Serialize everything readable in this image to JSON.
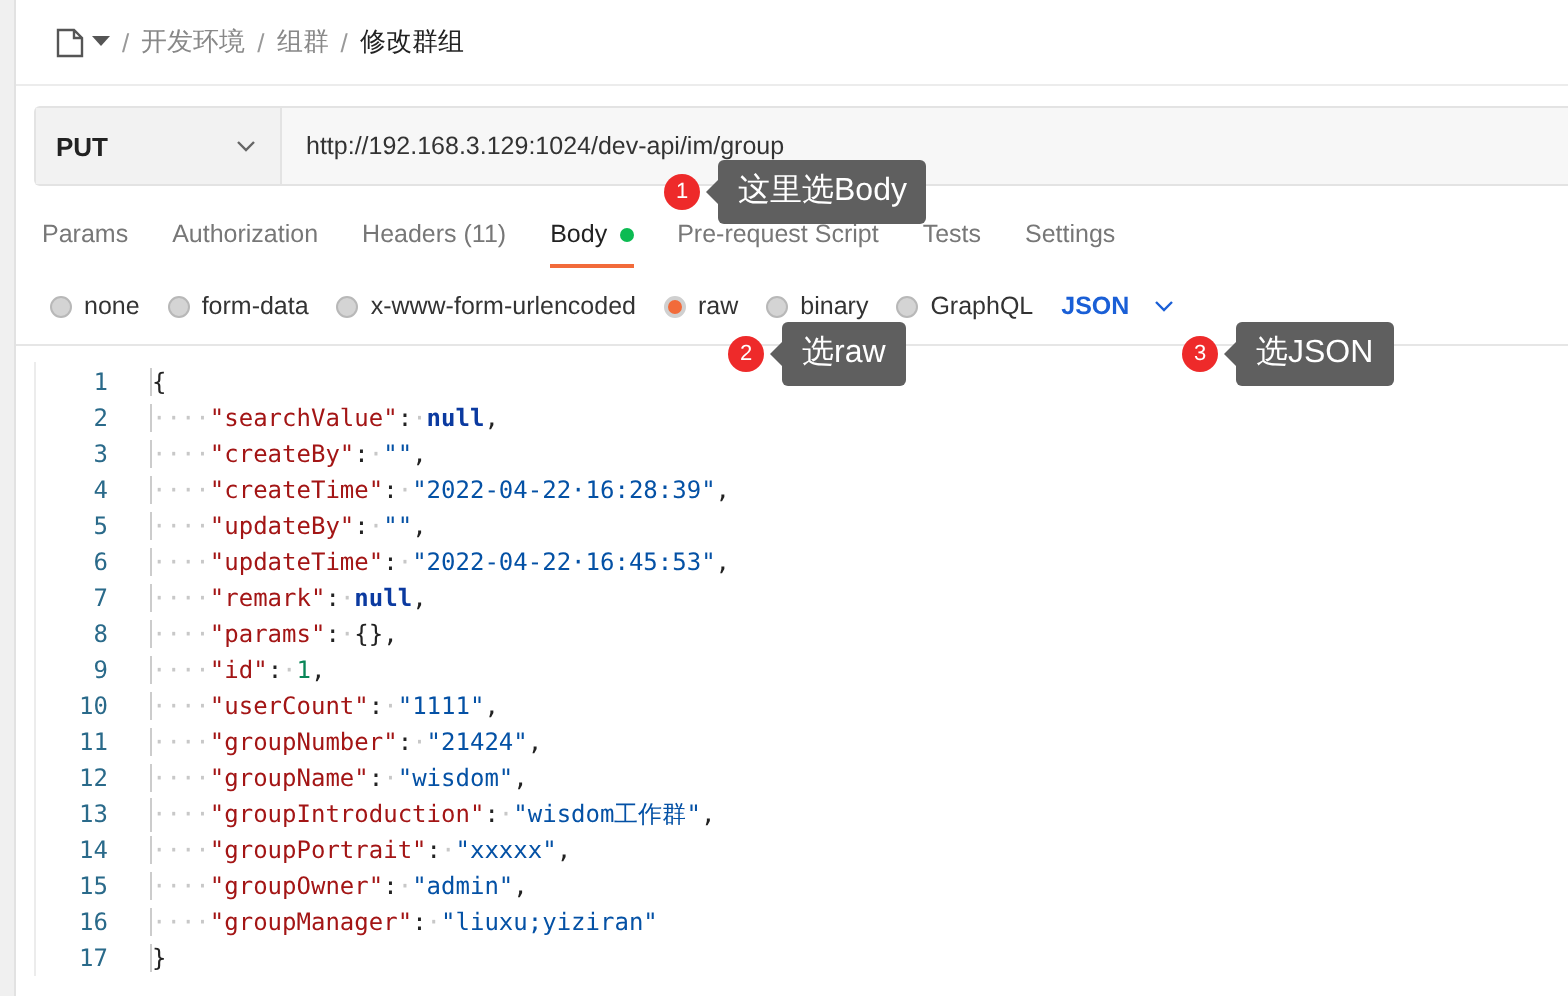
{
  "breadcrumb": [
    {
      "separator": "/",
      "label": "开发环境",
      "current": false
    },
    {
      "separator": "/",
      "label": "组群",
      "current": false
    },
    {
      "separator": "/",
      "label": "修改群组",
      "current": true
    }
  ],
  "request": {
    "method": "PUT",
    "url": "http://192.168.3.129:1024/dev-api/im/group"
  },
  "tabs": [
    {
      "label": "Params",
      "selected": false,
      "has_content": false
    },
    {
      "label": "Authorization",
      "selected": false,
      "has_content": false
    },
    {
      "label": "Headers (11)",
      "selected": false,
      "has_content": false
    },
    {
      "label": "Body",
      "selected": true,
      "has_content": true
    },
    {
      "label": "Pre-request Script",
      "selected": false,
      "has_content": false
    },
    {
      "label": "Tests",
      "selected": false,
      "has_content": false
    },
    {
      "label": "Settings",
      "selected": false,
      "has_content": false
    }
  ],
  "body_types": [
    {
      "label": "none",
      "selected": false
    },
    {
      "label": "form-data",
      "selected": false
    },
    {
      "label": "x-www-form-urlencoded",
      "selected": false
    },
    {
      "label": "raw",
      "selected": true
    },
    {
      "label": "binary",
      "selected": false
    },
    {
      "label": "GraphQL",
      "selected": false
    }
  ],
  "format": "JSON",
  "code_lines": [
    {
      "number": "1",
      "tokens": [
        {
          "kind": "brace",
          "text": "{"
        }
      ]
    },
    {
      "number": "2",
      "tokens": [
        {
          "kind": "ws",
          "text": "····"
        },
        {
          "kind": "key",
          "text": "\"searchValue\""
        },
        {
          "kind": "punct",
          "text": ":"
        },
        {
          "kind": "ws",
          "text": "·"
        },
        {
          "kind": "null",
          "text": "null"
        },
        {
          "kind": "punct",
          "text": ","
        }
      ]
    },
    {
      "number": "3",
      "tokens": [
        {
          "kind": "ws",
          "text": "····"
        },
        {
          "kind": "key",
          "text": "\"createBy\""
        },
        {
          "kind": "punct",
          "text": ":"
        },
        {
          "kind": "ws",
          "text": "·"
        },
        {
          "kind": "string",
          "text": "\"\""
        },
        {
          "kind": "punct",
          "text": ","
        }
      ]
    },
    {
      "number": "4",
      "tokens": [
        {
          "kind": "ws",
          "text": "····"
        },
        {
          "kind": "key",
          "text": "\"createTime\""
        },
        {
          "kind": "punct",
          "text": ":"
        },
        {
          "kind": "ws",
          "text": "·"
        },
        {
          "kind": "string",
          "text": "\"2022-04-22·16:28:39\""
        },
        {
          "kind": "punct",
          "text": ","
        }
      ]
    },
    {
      "number": "5",
      "tokens": [
        {
          "kind": "ws",
          "text": "····"
        },
        {
          "kind": "key",
          "text": "\"updateBy\""
        },
        {
          "kind": "punct",
          "text": ":"
        },
        {
          "kind": "ws",
          "text": "·"
        },
        {
          "kind": "string",
          "text": "\"\""
        },
        {
          "kind": "punct",
          "text": ","
        }
      ]
    },
    {
      "number": "6",
      "tokens": [
        {
          "kind": "ws",
          "text": "····"
        },
        {
          "kind": "key",
          "text": "\"updateTime\""
        },
        {
          "kind": "punct",
          "text": ":"
        },
        {
          "kind": "ws",
          "text": "·"
        },
        {
          "kind": "string",
          "text": "\"2022-04-22·16:45:53\""
        },
        {
          "kind": "punct",
          "text": ","
        }
      ]
    },
    {
      "number": "7",
      "tokens": [
        {
          "kind": "ws",
          "text": "····"
        },
        {
          "kind": "key",
          "text": "\"remark\""
        },
        {
          "kind": "punct",
          "text": ":"
        },
        {
          "kind": "ws",
          "text": "·"
        },
        {
          "kind": "null",
          "text": "null"
        },
        {
          "kind": "punct",
          "text": ","
        }
      ]
    },
    {
      "number": "8",
      "tokens": [
        {
          "kind": "ws",
          "text": "····"
        },
        {
          "kind": "key",
          "text": "\"params\""
        },
        {
          "kind": "punct",
          "text": ":"
        },
        {
          "kind": "ws",
          "text": "·"
        },
        {
          "kind": "punct",
          "text": "{},"
        }
      ]
    },
    {
      "number": "9",
      "tokens": [
        {
          "kind": "ws",
          "text": "····"
        },
        {
          "kind": "key",
          "text": "\"id\""
        },
        {
          "kind": "punct",
          "text": ":"
        },
        {
          "kind": "ws",
          "text": "·"
        },
        {
          "kind": "number",
          "text": "1"
        },
        {
          "kind": "punct",
          "text": ","
        }
      ]
    },
    {
      "number": "10",
      "tokens": [
        {
          "kind": "ws",
          "text": "····"
        },
        {
          "kind": "key",
          "text": "\"userCount\""
        },
        {
          "kind": "punct",
          "text": ":"
        },
        {
          "kind": "ws",
          "text": "·"
        },
        {
          "kind": "string",
          "text": "\"1111\""
        },
        {
          "kind": "punct",
          "text": ","
        }
      ]
    },
    {
      "number": "11",
      "tokens": [
        {
          "kind": "ws",
          "text": "····"
        },
        {
          "kind": "key",
          "text": "\"groupNumber\""
        },
        {
          "kind": "punct",
          "text": ":"
        },
        {
          "kind": "ws",
          "text": "·"
        },
        {
          "kind": "string",
          "text": "\"21424\""
        },
        {
          "kind": "punct",
          "text": ","
        }
      ]
    },
    {
      "number": "12",
      "tokens": [
        {
          "kind": "ws",
          "text": "····"
        },
        {
          "kind": "key",
          "text": "\"groupName\""
        },
        {
          "kind": "punct",
          "text": ":"
        },
        {
          "kind": "ws",
          "text": "·"
        },
        {
          "kind": "string",
          "text": "\"wisdom\""
        },
        {
          "kind": "punct",
          "text": ","
        }
      ]
    },
    {
      "number": "13",
      "tokens": [
        {
          "kind": "ws",
          "text": "····"
        },
        {
          "kind": "key",
          "text": "\"groupIntroduction\""
        },
        {
          "kind": "punct",
          "text": ":"
        },
        {
          "kind": "ws",
          "text": "·"
        },
        {
          "kind": "string",
          "text": "\"wisdom工作群\""
        },
        {
          "kind": "punct",
          "text": ","
        }
      ]
    },
    {
      "number": "14",
      "tokens": [
        {
          "kind": "ws",
          "text": "····"
        },
        {
          "kind": "key",
          "text": "\"groupPortrait\""
        },
        {
          "kind": "punct",
          "text": ":"
        },
        {
          "kind": "ws",
          "text": "·"
        },
        {
          "kind": "string",
          "text": "\"xxxxx\""
        },
        {
          "kind": "punct",
          "text": ","
        }
      ]
    },
    {
      "number": "15",
      "tokens": [
        {
          "kind": "ws",
          "text": "····"
        },
        {
          "kind": "key",
          "text": "\"groupOwner\""
        },
        {
          "kind": "punct",
          "text": ":"
        },
        {
          "kind": "ws",
          "text": "·"
        },
        {
          "kind": "string",
          "text": "\"admin\""
        },
        {
          "kind": "punct",
          "text": ","
        }
      ]
    },
    {
      "number": "16",
      "tokens": [
        {
          "kind": "ws",
          "text": "····"
        },
        {
          "kind": "key",
          "text": "\"groupManager\""
        },
        {
          "kind": "punct",
          "text": ":"
        },
        {
          "kind": "ws",
          "text": "·"
        },
        {
          "kind": "string",
          "text": "\"liuxu;yiziran\""
        }
      ]
    },
    {
      "number": "17",
      "tokens": [
        {
          "kind": "brace",
          "text": "}"
        }
      ]
    }
  ],
  "annotations": [
    {
      "number": "1",
      "text": "这里选Body"
    },
    {
      "number": "2",
      "text": "选raw"
    },
    {
      "number": "3",
      "text": "选JSON"
    }
  ]
}
